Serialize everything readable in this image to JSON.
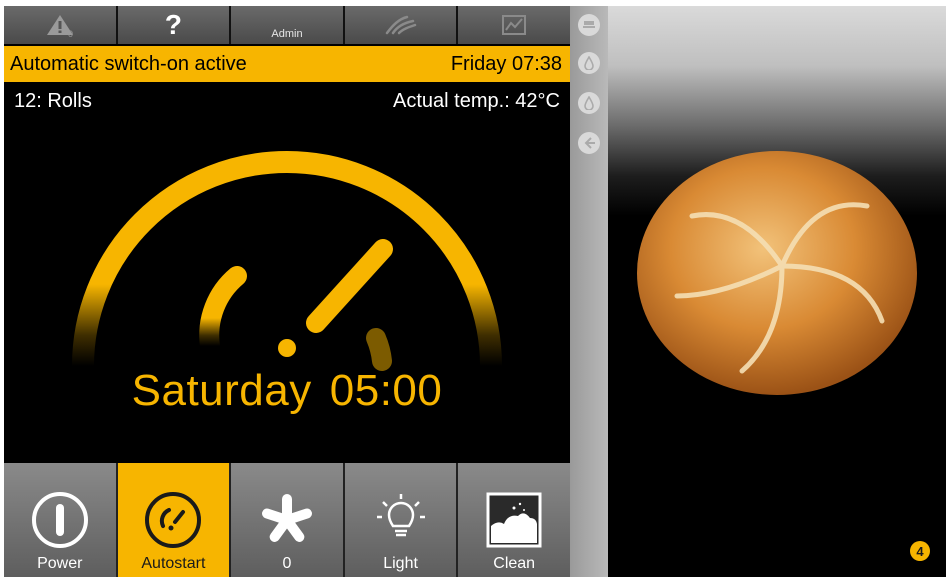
{
  "topbar": {
    "warning": {
      "count": "0"
    },
    "help": {
      "symbol": "?"
    },
    "admin": {
      "label": "Admin"
    }
  },
  "status": {
    "message": "Automatic switch-on active",
    "clock": "Friday 07:38"
  },
  "program": {
    "name": "12: Rolls",
    "actual_temp": "Actual temp.: 42°C"
  },
  "schedule": {
    "day": "Saturday",
    "time": "05:00"
  },
  "bottombar": {
    "buttons": [
      {
        "label": "Power",
        "icon": "power-icon",
        "active": false
      },
      {
        "label": "Autostart",
        "icon": "autostart-icon",
        "active": true
      },
      {
        "label": "0",
        "icon": "fan-icon",
        "active": false
      },
      {
        "label": "Light",
        "icon": "light-bulb-icon",
        "active": false
      },
      {
        "label": "Clean",
        "icon": "clean-icon",
        "active": false
      }
    ]
  },
  "side_icons": [
    "tray-icon",
    "drop-icon",
    "drop-icon",
    "arrow-left-icon"
  ],
  "panel": {
    "badge": "4"
  },
  "colors": {
    "accent": "#f7b500",
    "screen_bg": "#000000",
    "button_gray": "#6e6e6e"
  }
}
